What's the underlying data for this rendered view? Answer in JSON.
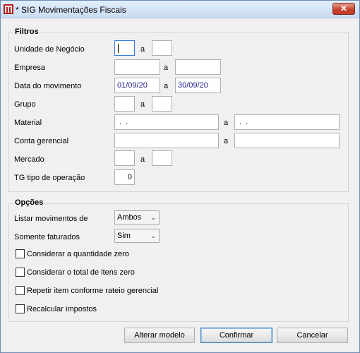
{
  "window": {
    "title": "* SIG Movimentações Fiscais",
    "close_glyph": "✕"
  },
  "filtros": {
    "title": "Filtros",
    "separator": "a",
    "unidade": {
      "label": "Unidade de Negócio",
      "from": "",
      "to": ""
    },
    "empresa": {
      "label": "Empresa",
      "from": "",
      "to": ""
    },
    "data": {
      "label": "Data do movimento",
      "from": "01/09/20",
      "to": "30/09/20"
    },
    "grupo": {
      "label": "Grupo",
      "from": "",
      "to": ""
    },
    "material": {
      "label": "Material",
      "from": " .  .",
      "to": " .  ."
    },
    "conta": {
      "label": "Conta gerencial",
      "from": "",
      "to": ""
    },
    "mercado": {
      "label": "Mercado",
      "from": "",
      "to": ""
    },
    "tg": {
      "label": "TG tipo de operação",
      "value": "0"
    }
  },
  "opcoes": {
    "title": "Opções",
    "listar": {
      "label": "Listar movimentos de",
      "value": "Ambos"
    },
    "faturados": {
      "label": "Somente faturados",
      "value": "Sim"
    },
    "checks": [
      {
        "label": "Considerar a quantidade zero",
        "checked": false
      },
      {
        "label": "Considerar o total de itens zero",
        "checked": false
      },
      {
        "label": "Repetir item conforme rateio gerencial",
        "checked": false
      },
      {
        "label": "Recalcular impostos",
        "checked": false
      }
    ]
  },
  "buttons": {
    "alterar": "Alterar modelo",
    "confirmar": "Confirmar",
    "cancelar": "Cancelar"
  }
}
